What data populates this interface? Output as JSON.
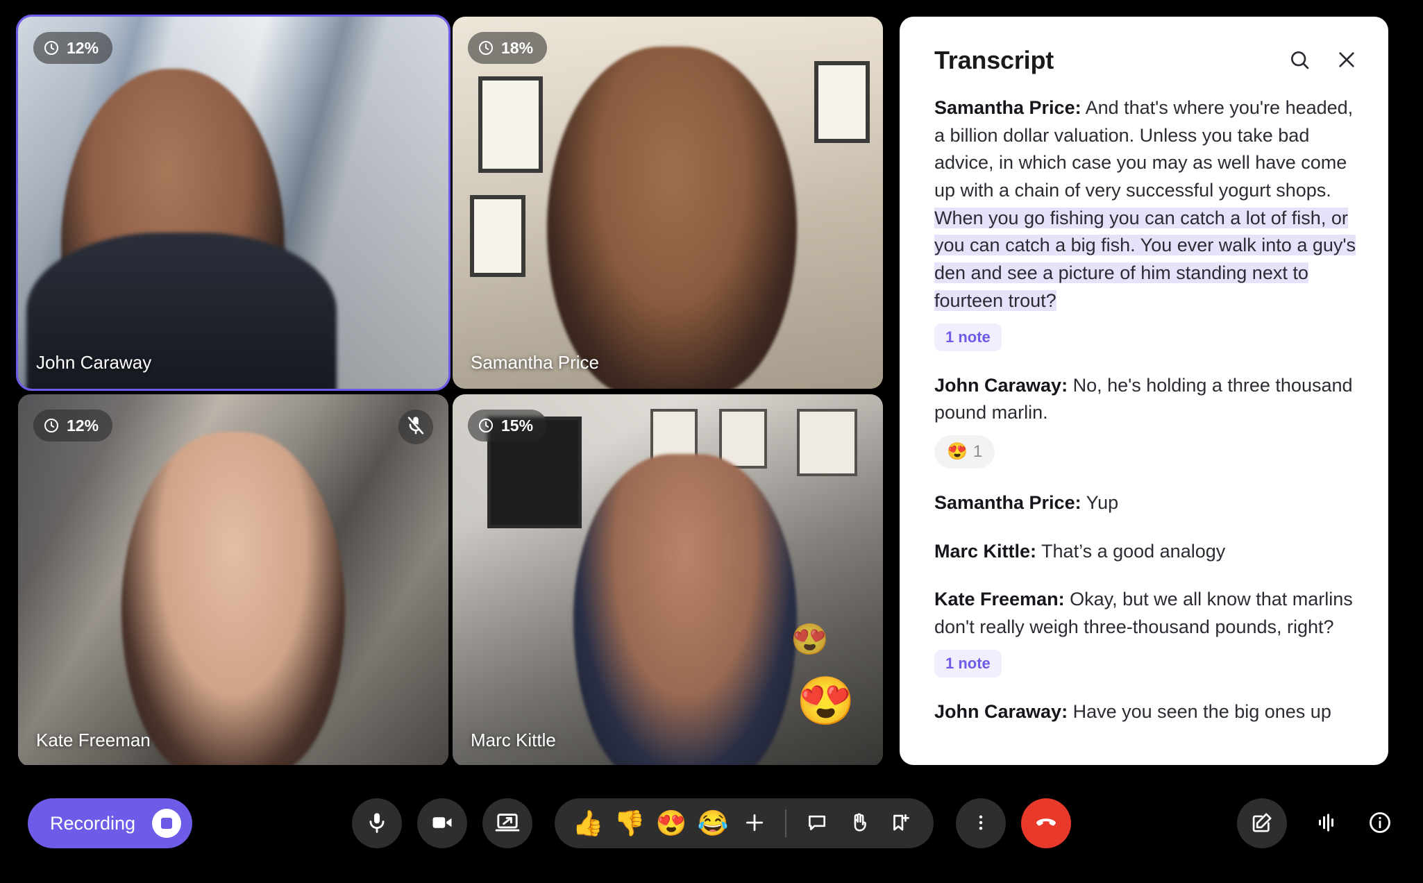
{
  "theme": {
    "accent": "#6C5CE7",
    "danger": "#E8392B",
    "panel_bg": "#FFFFFF",
    "app_bg": "#000000",
    "highlight": "#E6E2FA",
    "note_chip_bg": "#F1EEFD"
  },
  "grid": {
    "tiles": [
      {
        "name": "John Caraway",
        "talk_percent": "12%",
        "active_speaker": true,
        "muted": false,
        "scene": "scene-john",
        "reactions": []
      },
      {
        "name": "Samantha Price",
        "talk_percent": "18%",
        "active_speaker": false,
        "muted": false,
        "scene": "scene-sam",
        "reactions": []
      },
      {
        "name": "Kate Freeman",
        "talk_percent": "12%",
        "active_speaker": false,
        "muted": true,
        "scene": "scene-kate",
        "reactions": []
      },
      {
        "name": "Marc Kittle",
        "talk_percent": "15%",
        "active_speaker": false,
        "muted": false,
        "scene": "scene-marc",
        "reactions": [
          "😍",
          "😍"
        ]
      }
    ]
  },
  "panel": {
    "title": "Transcript",
    "search_icon": "search-icon",
    "close_icon": "close-icon",
    "entries": [
      {
        "speaker": "Samantha Price:",
        "text_plain": " And that's where you're headed, a billion dollar valuation. Unless you take bad advice, in which case you may as well have come up with a chain of very successful yogurt shops. ",
        "text_highlight": "When you go fishing you can catch a lot of fish, or you can catch a big fish. You ever walk into a guy's den and see a picture of him standing next to fourteen trout?",
        "note_badge": "1 note",
        "reaction": null
      },
      {
        "speaker": "John Caraway:",
        "text_plain": " No, he's holding a three thousand pound marlin.",
        "text_highlight": "",
        "note_badge": null,
        "reaction": {
          "emoji": "😍",
          "count": "1"
        }
      },
      {
        "speaker": "Samantha Price:",
        "text_plain": " Yup",
        "text_highlight": "",
        "note_badge": null,
        "reaction": null
      },
      {
        "speaker": "Marc Kittle:",
        "text_plain": " That’s a good analogy",
        "text_highlight": "",
        "note_badge": null,
        "reaction": null
      },
      {
        "speaker": "Kate Freeman:",
        "text_plain": " Okay, but we all know that marlins don't really weigh three-thousand pounds, right?",
        "text_highlight": "",
        "note_badge": "1 note",
        "reaction": null
      },
      {
        "speaker": "John Caraway:",
        "text_plain": " Have you seen the big ones up",
        "text_highlight": "",
        "note_badge": null,
        "reaction": null
      }
    ]
  },
  "bottombar": {
    "recording_label": "Recording",
    "recording_icon": "stop-record-icon",
    "controls": [
      {
        "name": "microphone-button",
        "icon": "microphone-icon"
      },
      {
        "name": "camera-button",
        "icon": "video-camera-icon"
      },
      {
        "name": "share-screen-button",
        "icon": "screen-share-icon"
      }
    ],
    "reactions": [
      {
        "name": "thumbs-up-reaction",
        "emoji": "👍"
      },
      {
        "name": "thumbs-down-reaction",
        "emoji": "👎"
      },
      {
        "name": "heart-eyes-reaction",
        "emoji": "😍"
      },
      {
        "name": "laughing-reaction",
        "emoji": "😂"
      },
      {
        "name": "more-reactions-button",
        "emoji": "＋"
      }
    ],
    "tools": [
      {
        "name": "chat-button",
        "icon": "chat-bubble-icon"
      },
      {
        "name": "raise-hand-button",
        "icon": "raised-hand-icon"
      },
      {
        "name": "bookmark-button",
        "icon": "bookmark-add-icon"
      }
    ],
    "more_icon": "more-vertical-icon",
    "hangup_icon": "end-call-icon",
    "right": [
      {
        "name": "notes-button",
        "icon": "compose-note-icon"
      },
      {
        "name": "transcript-button",
        "icon": "waveform-icon"
      },
      {
        "name": "info-button",
        "icon": "info-circle-icon"
      }
    ]
  }
}
